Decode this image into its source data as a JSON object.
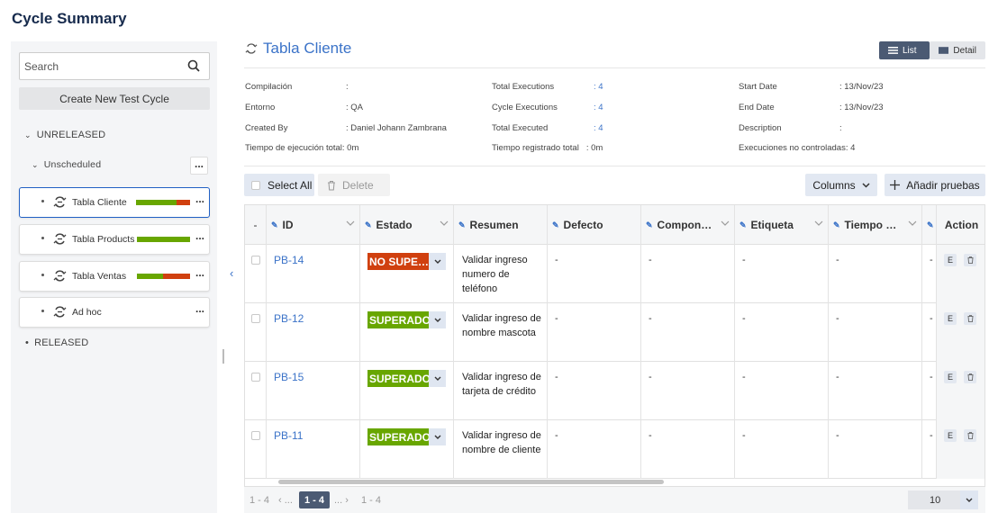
{
  "page": {
    "title": "Cycle Summary"
  },
  "sidebar": {
    "search_placeholder": "Search",
    "create_label": "Create New Test Cycle",
    "unreleased_label": "UNRELEASED",
    "unscheduled_label": "Unscheduled",
    "released_label": "RELEASED",
    "cycles": [
      {
        "label": "Tabla Cliente",
        "progress": {
          "passed": 0.75,
          "failed": 0.25
        }
      },
      {
        "label": "Tabla Products",
        "progress": {
          "passed": 1.0,
          "failed": 0.0
        }
      },
      {
        "label": "Tabla Ventas",
        "progress": {
          "passed": 0.5,
          "failed": 0.5
        }
      },
      {
        "label": "Ad hoc"
      }
    ],
    "more_label": "..."
  },
  "header": {
    "title": "Tabla Cliente",
    "list_label": "List",
    "detail_label": "Detail"
  },
  "info": {
    "compilacion_label": "Compilación",
    "compilacion_value": ":",
    "entorno_label": "Entorno",
    "entorno_value": ": QA",
    "created_by_label": "Created By",
    "created_by_value": ": Daniel Johann Zambrana",
    "tiempo_ejecucion_label": "Tiempo de ejecución total",
    "tiempo_ejecucion_value": ": 0m",
    "total_exec_label": "Total Executions",
    "total_exec_value": ": 4",
    "cycle_exec_label": "Cycle Executions",
    "cycle_exec_value": ": 4",
    "total_executed_label": "Total Executed",
    "total_executed_value": ": 4",
    "tiempo_registrado_label": "Tiempo registrado total",
    "tiempo_registrado_value": ": 0m",
    "start_label": "Start Date",
    "start_value": ": 13/Nov/23",
    "end_label": "End Date",
    "end_value": ": 13/Nov/23",
    "description_label": "Description",
    "description_value": ":",
    "no_controladas_label": "Execuciones no controladas",
    "no_controladas_value": ": 4"
  },
  "toolbar": {
    "select_all": "Select All",
    "delete": "Delete",
    "columns": "Columns",
    "add_tests": "Añadir pruebas"
  },
  "table": {
    "headers": {
      "sort": "-",
      "id": "ID",
      "estado": "Estado",
      "resumen": "Resumen",
      "defecto": "Defecto",
      "componente": "Compon…",
      "etiqueta": "Etiqueta",
      "tiempo": "Tiempo …",
      "action": "Action"
    },
    "rows": [
      {
        "id": "PB-14",
        "estado": "NO SUPE…",
        "estado_color": "#d0400f",
        "resumen": "Validar ingreso numero de teléfono",
        "defecto": "-",
        "componente": "-",
        "etiqueta": "-",
        "tiempo": "-",
        "extra": "-"
      },
      {
        "id": "PB-12",
        "estado": "SUPERADO",
        "estado_color": "#68a600",
        "resumen": "Validar ingreso de nombre mascota",
        "defecto": "-",
        "componente": "-",
        "etiqueta": "-",
        "tiempo": "-",
        "extra": "-"
      },
      {
        "id": "PB-15",
        "estado": "SUPERADO",
        "estado_color": "#68a600",
        "resumen": "Validar ingreso de tarjeta de crédito",
        "defecto": "-",
        "componente": "-",
        "etiqueta": "-",
        "tiempo": "-",
        "extra": "-"
      },
      {
        "id": "PB-11",
        "estado": "SUPERADO",
        "estado_color": "#68a600",
        "resumen": "Validar ingreso de nombre de cliente",
        "defecto": "-",
        "componente": "-",
        "etiqueta": "-",
        "tiempo": "-",
        "extra": "-"
      }
    ],
    "action_edit": "E"
  },
  "pagination": {
    "range_left": "1 - 4",
    "prev": "‹ ...",
    "current": "1 - 4",
    "next": "... ›",
    "range_right": "1 - 4",
    "per_page": "10"
  },
  "colors": {
    "accent": "#3b73c8",
    "passed": "#68a600",
    "failed": "#d0400f",
    "dark": "#4b5a73"
  }
}
